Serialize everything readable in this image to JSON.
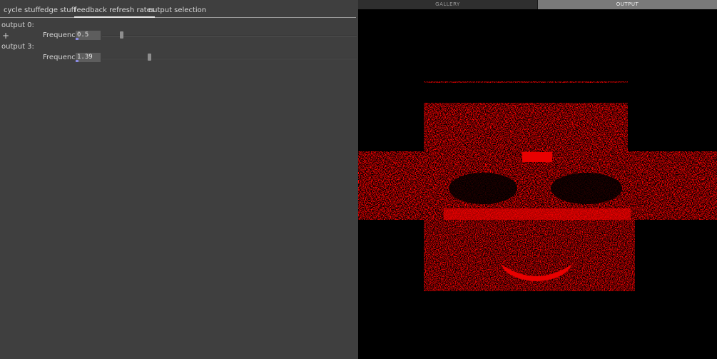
{
  "tabs": [
    {
      "label": "cycle stuff",
      "active": false
    },
    {
      "label": "edge stuff",
      "active": false
    },
    {
      "label": "feedback refresh rates",
      "active": true
    },
    {
      "label": "output selection",
      "active": false
    }
  ],
  "outputs": [
    {
      "label": "output 0:",
      "expand_symbol": "+",
      "param_label": "Frequency",
      "value": "0.5",
      "slider_fraction": 0.07
    },
    {
      "label": "output 3:",
      "param_label": "Frequency",
      "value": "1.39",
      "slider_fraction": 0.18
    }
  ],
  "view_tabs": {
    "gallery": "GALLERY",
    "output": "OUTPUT"
  },
  "colors": {
    "panel": "#3f3f3f",
    "image_red": "#e80000",
    "background": "#000000"
  }
}
